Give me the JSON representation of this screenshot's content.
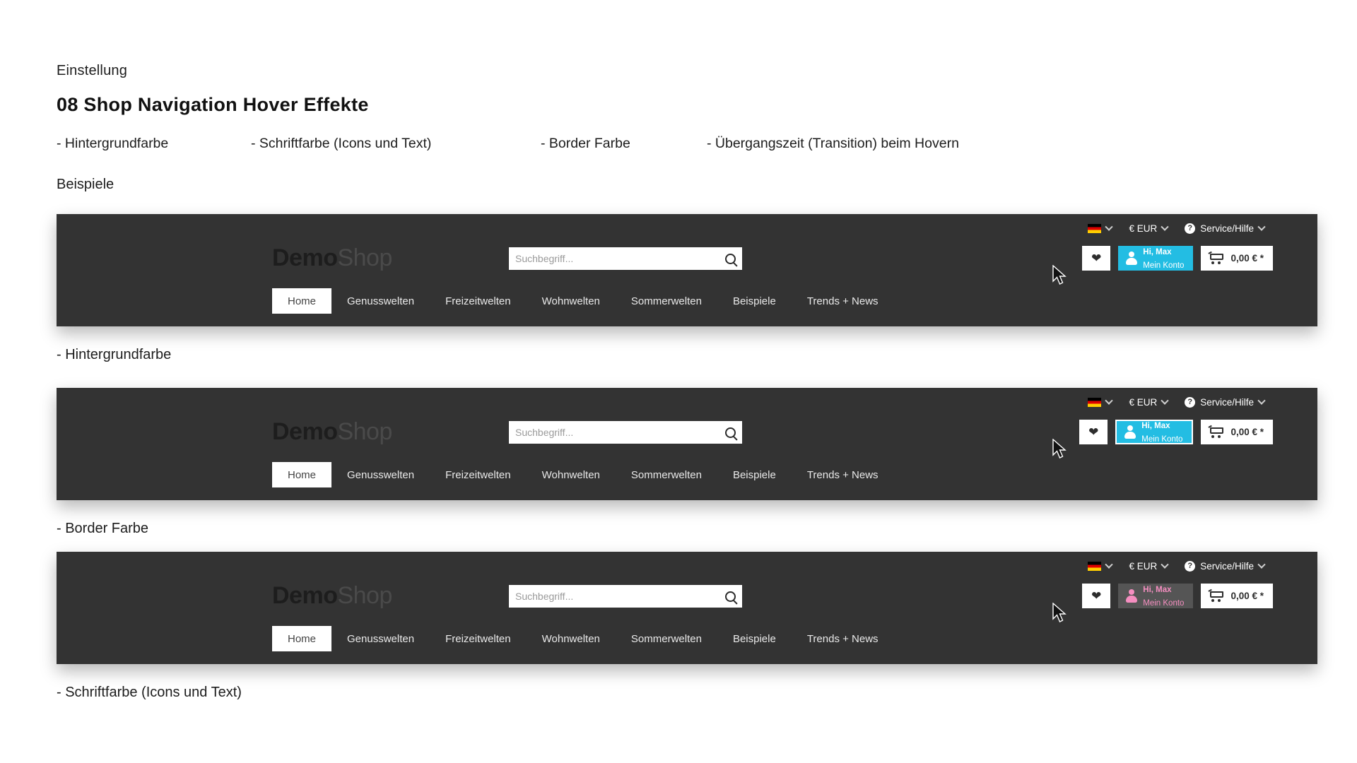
{
  "intro": {
    "eyebrow": "Einstellung",
    "headline": "08 Shop Navigation Hover Effekte",
    "params": [
      "- Hintergrundfarbe",
      "- Schriftfarbe (Icons und Text)",
      "- Border Farbe",
      "- Übergangszeit (Transition) beim Hovern"
    ],
    "examples_label": "Beispiele"
  },
  "shop": {
    "utility": {
      "language_icon": "german-flag-icon",
      "language_chevron": "chevron-down-icon",
      "currency_label": "€ EUR",
      "currency_chevron": "chevron-down-icon",
      "service_icon": "question-circle-icon",
      "service_label": "Service/Hilfe",
      "service_chevron": "chevron-down-icon"
    },
    "logo": {
      "bold": "Demo",
      "light": "Shop"
    },
    "search": {
      "placeholder": "Suchbegriff...",
      "value": "",
      "icon": "search-icon"
    },
    "actions": {
      "wishlist_icon": "heart-icon",
      "account_icon": "user-icon",
      "account_line1": "Hi, Max",
      "account_line2": "Mein Konto",
      "cart_icon": "shopping-cart-icon",
      "cart_total": "0,00 € *"
    },
    "nav": [
      {
        "label": "Home",
        "active": true
      },
      {
        "label": "Genusswelten",
        "active": false
      },
      {
        "label": "Freizeitwelten",
        "active": false
      },
      {
        "label": "Wohnwelten",
        "active": false
      },
      {
        "label": "Sommerwelten",
        "active": false
      },
      {
        "label": "Beispiele",
        "active": false
      },
      {
        "label": "Trends + News",
        "active": false
      }
    ]
  },
  "examples": [
    {
      "caption": "- Hintergrundfarbe"
    },
    {
      "caption": "- Border Farbe"
    },
    {
      "caption": "- Schriftfarbe (Icons und Text)"
    }
  ],
  "colors": {
    "bar_background": "#333333",
    "hover_cyan": "#23bde3",
    "hover_pink": "#f58ec0",
    "hover_grey": "#555555",
    "button_white": "#ffffff"
  }
}
